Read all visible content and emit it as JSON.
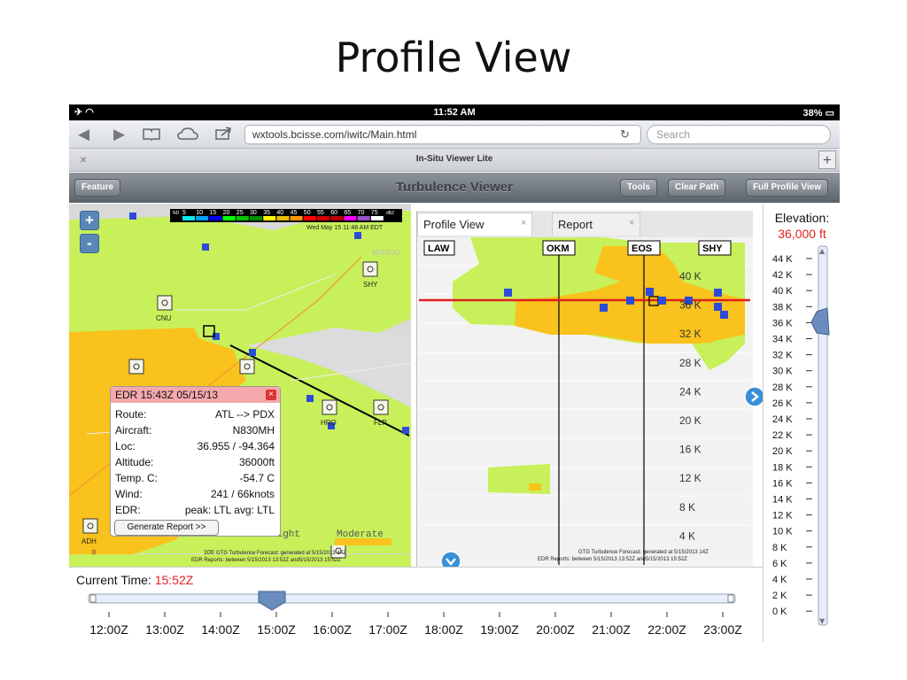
{
  "slide": {
    "title": "Profile View"
  },
  "status": {
    "time": "11:52 AM",
    "battery": "38%"
  },
  "browser": {
    "url": "wxtools.bcisse.com/iwitc/Main.html",
    "search_placeholder": "Search",
    "tab_title": "In-Situ Viewer Lite",
    "tab_close": "×",
    "tab_add": "+"
  },
  "toolbar": {
    "feature_label": "Feature",
    "title": "Turbulence Viewer",
    "tools_label": "Tools",
    "clear_path_label": "Clear Path",
    "full_profile_label": "Full Profile View"
  },
  "map": {
    "zoom_in": "+",
    "zoom_out": "-",
    "legend_prefix": "ND",
    "legend_values": [
      "5",
      "10",
      "15",
      "20",
      "25",
      "30",
      "35",
      "40",
      "45",
      "50",
      "55",
      "60",
      "65",
      "70",
      "75"
    ],
    "legend_unit": "dBZ",
    "legend_colors": [
      "#02e8e8",
      "#019ff4",
      "#0300f4",
      "#02fd02",
      "#01c501",
      "#008e00",
      "#fdf802",
      "#e5bc00",
      "#fd9500",
      "#fd0000",
      "#d40000",
      "#bc0000",
      "#f800fd",
      "#9854c6",
      "#fdfdfd"
    ],
    "timestamp": "Wed May 15 11:48 AM EDT",
    "region_label": "MISSOU",
    "sites": [
      {
        "id": "SHY",
        "label": "SHY"
      },
      {
        "id": "CNU",
        "label": "CNU"
      },
      {
        "id": "HRO",
        "label": "HRO"
      },
      {
        "id": "FLP",
        "label": "FLP"
      },
      {
        "id": "ADH",
        "label": "ADH"
      }
    ],
    "scale_light": "Light",
    "scale_moderate": "Moderate",
    "scale_zero": "0",
    "scale_hundred": "100",
    "footer_line1": "GTG Turbulence Forecast: generated at 5/15/2013 14Z",
    "footer_line2": "EDR Reports: between 5/15/2013 13:52Z and5/15/2013 15:52Z"
  },
  "popup": {
    "title": "EDR 15:43Z 05/15/13",
    "close": "×",
    "rows": [
      {
        "k": "Route:",
        "v": "ATL --> PDX"
      },
      {
        "k": "Aircraft:",
        "v": "N830MH"
      },
      {
        "k": "Loc:",
        "v": "36.955 / -94.364"
      },
      {
        "k": "Altitude:",
        "v": "36000ft"
      },
      {
        "k": "Temp. C:",
        "v": "-54.7 C"
      },
      {
        "k": "Wind:",
        "v": "241 / 66knots"
      },
      {
        "k": "EDR:",
        "v": "peak: LTL avg: LTL"
      }
    ],
    "button": "Generate Report >>"
  },
  "profile": {
    "tab_profile": "Profile View",
    "tab_report": "Report",
    "tab_x": "×",
    "waypoints": [
      "LAW",
      "OKM",
      "EOS",
      "SHY"
    ],
    "altitudes": [
      "40 K",
      "36 K",
      "32 K",
      "28 K",
      "24 K",
      "20 K",
      "16 K",
      "12 K",
      "8 K",
      "4 K"
    ],
    "footer_line1": "GTG Turbulence Forecast: generated at 5/15/2013 14Z",
    "footer_line2": "EDR Reports: between 5/15/2013 13:52Z and5/15/2013 15:52Z"
  },
  "elevation": {
    "label": "Elevation:",
    "value": "36,000 ft",
    "ticks": [
      "44 K",
      "42 K",
      "40 K",
      "38 K",
      "36 K",
      "34 K",
      "32 K",
      "30 K",
      "28 K",
      "26 K",
      "24 K",
      "22 K",
      "20 K",
      "18 K",
      "16 K",
      "14 K",
      "12 K",
      "10 K",
      "8 K",
      "6 K",
      "4 K",
      "2 K",
      "0 K"
    ]
  },
  "timeline": {
    "label": "Current Time:",
    "value": "15:52Z",
    "times": [
      "12:00Z",
      "13:00Z",
      "14:00Z",
      "15:00Z",
      "16:00Z",
      "17:00Z",
      "18:00Z",
      "19:00Z",
      "20:00Z",
      "21:00Z",
      "22:00Z",
      "23:00Z"
    ]
  }
}
